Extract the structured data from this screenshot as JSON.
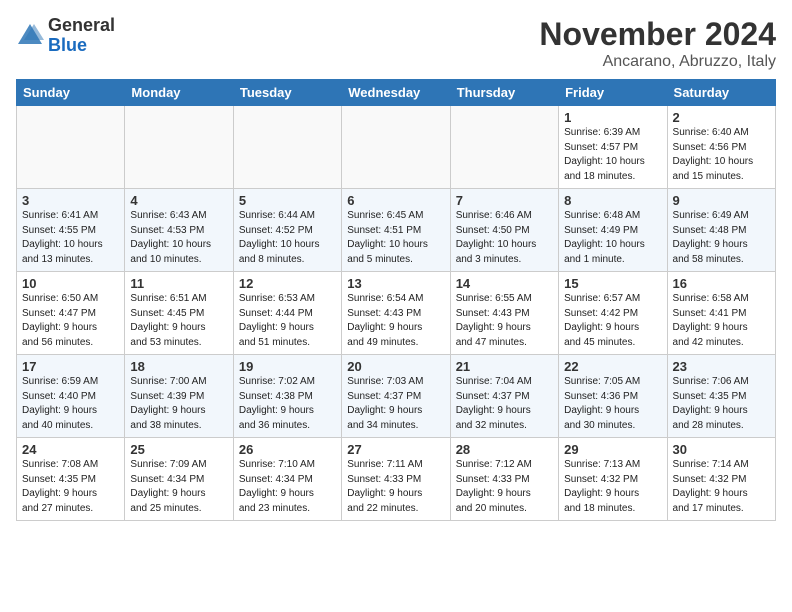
{
  "header": {
    "logo_general": "General",
    "logo_blue": "Blue",
    "title": "November 2024",
    "location": "Ancarano, Abruzzo, Italy"
  },
  "weekdays": [
    "Sunday",
    "Monday",
    "Tuesday",
    "Wednesday",
    "Thursday",
    "Friday",
    "Saturday"
  ],
  "weeks": [
    [
      {
        "day": "",
        "info": ""
      },
      {
        "day": "",
        "info": ""
      },
      {
        "day": "",
        "info": ""
      },
      {
        "day": "",
        "info": ""
      },
      {
        "day": "",
        "info": ""
      },
      {
        "day": "1",
        "info": "Sunrise: 6:39 AM\nSunset: 4:57 PM\nDaylight: 10 hours\nand 18 minutes."
      },
      {
        "day": "2",
        "info": "Sunrise: 6:40 AM\nSunset: 4:56 PM\nDaylight: 10 hours\nand 15 minutes."
      }
    ],
    [
      {
        "day": "3",
        "info": "Sunrise: 6:41 AM\nSunset: 4:55 PM\nDaylight: 10 hours\nand 13 minutes."
      },
      {
        "day": "4",
        "info": "Sunrise: 6:43 AM\nSunset: 4:53 PM\nDaylight: 10 hours\nand 10 minutes."
      },
      {
        "day": "5",
        "info": "Sunrise: 6:44 AM\nSunset: 4:52 PM\nDaylight: 10 hours\nand 8 minutes."
      },
      {
        "day": "6",
        "info": "Sunrise: 6:45 AM\nSunset: 4:51 PM\nDaylight: 10 hours\nand 5 minutes."
      },
      {
        "day": "7",
        "info": "Sunrise: 6:46 AM\nSunset: 4:50 PM\nDaylight: 10 hours\nand 3 minutes."
      },
      {
        "day": "8",
        "info": "Sunrise: 6:48 AM\nSunset: 4:49 PM\nDaylight: 10 hours\nand 1 minute."
      },
      {
        "day": "9",
        "info": "Sunrise: 6:49 AM\nSunset: 4:48 PM\nDaylight: 9 hours\nand 58 minutes."
      }
    ],
    [
      {
        "day": "10",
        "info": "Sunrise: 6:50 AM\nSunset: 4:47 PM\nDaylight: 9 hours\nand 56 minutes."
      },
      {
        "day": "11",
        "info": "Sunrise: 6:51 AM\nSunset: 4:45 PM\nDaylight: 9 hours\nand 53 minutes."
      },
      {
        "day": "12",
        "info": "Sunrise: 6:53 AM\nSunset: 4:44 PM\nDaylight: 9 hours\nand 51 minutes."
      },
      {
        "day": "13",
        "info": "Sunrise: 6:54 AM\nSunset: 4:43 PM\nDaylight: 9 hours\nand 49 minutes."
      },
      {
        "day": "14",
        "info": "Sunrise: 6:55 AM\nSunset: 4:43 PM\nDaylight: 9 hours\nand 47 minutes."
      },
      {
        "day": "15",
        "info": "Sunrise: 6:57 AM\nSunset: 4:42 PM\nDaylight: 9 hours\nand 45 minutes."
      },
      {
        "day": "16",
        "info": "Sunrise: 6:58 AM\nSunset: 4:41 PM\nDaylight: 9 hours\nand 42 minutes."
      }
    ],
    [
      {
        "day": "17",
        "info": "Sunrise: 6:59 AM\nSunset: 4:40 PM\nDaylight: 9 hours\nand 40 minutes."
      },
      {
        "day": "18",
        "info": "Sunrise: 7:00 AM\nSunset: 4:39 PM\nDaylight: 9 hours\nand 38 minutes."
      },
      {
        "day": "19",
        "info": "Sunrise: 7:02 AM\nSunset: 4:38 PM\nDaylight: 9 hours\nand 36 minutes."
      },
      {
        "day": "20",
        "info": "Sunrise: 7:03 AM\nSunset: 4:37 PM\nDaylight: 9 hours\nand 34 minutes."
      },
      {
        "day": "21",
        "info": "Sunrise: 7:04 AM\nSunset: 4:37 PM\nDaylight: 9 hours\nand 32 minutes."
      },
      {
        "day": "22",
        "info": "Sunrise: 7:05 AM\nSunset: 4:36 PM\nDaylight: 9 hours\nand 30 minutes."
      },
      {
        "day": "23",
        "info": "Sunrise: 7:06 AM\nSunset: 4:35 PM\nDaylight: 9 hours\nand 28 minutes."
      }
    ],
    [
      {
        "day": "24",
        "info": "Sunrise: 7:08 AM\nSunset: 4:35 PM\nDaylight: 9 hours\nand 27 minutes."
      },
      {
        "day": "25",
        "info": "Sunrise: 7:09 AM\nSunset: 4:34 PM\nDaylight: 9 hours\nand 25 minutes."
      },
      {
        "day": "26",
        "info": "Sunrise: 7:10 AM\nSunset: 4:34 PM\nDaylight: 9 hours\nand 23 minutes."
      },
      {
        "day": "27",
        "info": "Sunrise: 7:11 AM\nSunset: 4:33 PM\nDaylight: 9 hours\nand 22 minutes."
      },
      {
        "day": "28",
        "info": "Sunrise: 7:12 AM\nSunset: 4:33 PM\nDaylight: 9 hours\nand 20 minutes."
      },
      {
        "day": "29",
        "info": "Sunrise: 7:13 AM\nSunset: 4:32 PM\nDaylight: 9 hours\nand 18 minutes."
      },
      {
        "day": "30",
        "info": "Sunrise: 7:14 AM\nSunset: 4:32 PM\nDaylight: 9 hours\nand 17 minutes."
      }
    ]
  ]
}
